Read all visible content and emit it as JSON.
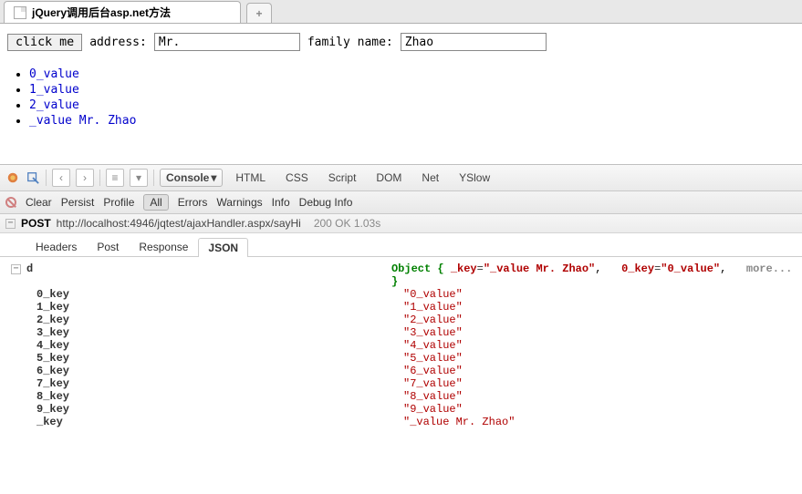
{
  "tab": {
    "title": "jQuery调用后台asp.net方法"
  },
  "form": {
    "button_label": "click me",
    "address_label": "address:",
    "address_value": "Mr.",
    "family_label": "family name:",
    "family_value": "Zhao"
  },
  "list": [
    "0_value",
    "1_value",
    "2_value",
    "_value Mr. Zhao"
  ],
  "devtabs": {
    "console": "Console",
    "html": "HTML",
    "css": "CSS",
    "script": "Script",
    "dom": "DOM",
    "net": "Net",
    "yslow": "YSlow"
  },
  "subbar": {
    "clear": "Clear",
    "persist": "Persist",
    "profile": "Profile",
    "all": "All",
    "errors": "Errors",
    "warnings": "Warnings",
    "info": "Info",
    "debug": "Debug Info"
  },
  "request": {
    "method": "POST",
    "url": "http://localhost:4946/jqtest/ajaxHandler.aspx/sayHi",
    "status": "200 OK 1.03s"
  },
  "resp_tabs": {
    "headers": "Headers",
    "post": "Post",
    "response": "Response",
    "json": "JSON"
  },
  "json": {
    "root": "d",
    "obj_word": "Object",
    "preview_k1": "_key",
    "preview_v1": "\"_value Mr. Zhao\"",
    "preview_k2": "0_key",
    "preview_v2": "\"0_value\"",
    "more": "more...",
    "children": [
      {
        "k": "0_key",
        "v": "\"0_value\""
      },
      {
        "k": "1_key",
        "v": "\"1_value\""
      },
      {
        "k": "2_key",
        "v": "\"2_value\""
      },
      {
        "k": "3_key",
        "v": "\"3_value\""
      },
      {
        "k": "4_key",
        "v": "\"4_value\""
      },
      {
        "k": "5_key",
        "v": "\"5_value\""
      },
      {
        "k": "6_key",
        "v": "\"6_value\""
      },
      {
        "k": "7_key",
        "v": "\"7_value\""
      },
      {
        "k": "8_key",
        "v": "\"8_value\""
      },
      {
        "k": "9_key",
        "v": "\"9_value\""
      },
      {
        "k": "_key",
        "v": "\"_value Mr. Zhao\""
      }
    ]
  }
}
